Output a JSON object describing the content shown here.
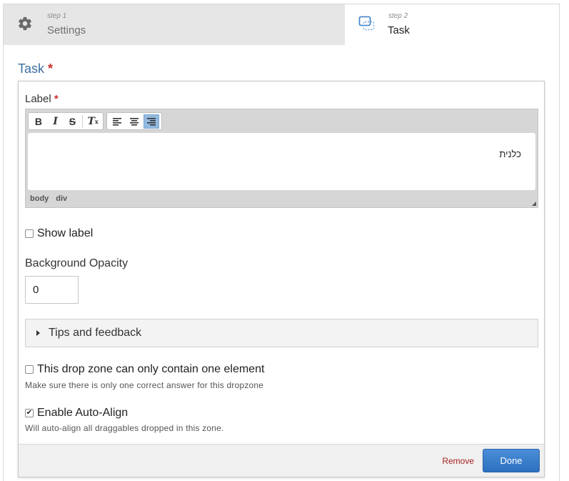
{
  "wizard": {
    "tabs": [
      {
        "step": "step 1",
        "name": "Settings",
        "icon": "gear-icon"
      },
      {
        "step": "step 2",
        "name": "Task",
        "icon": "task-icon"
      }
    ]
  },
  "section": {
    "title": "Task",
    "required_mark": "*"
  },
  "label_field": {
    "title": "Label",
    "required_mark": "*",
    "toolbar": {
      "bold": "B",
      "italic": "I",
      "strike": "S",
      "clear_format": "T",
      "clear_sub": "x"
    },
    "content": "כלנית",
    "path": [
      "body",
      "div"
    ]
  },
  "show_label": {
    "label": "Show label",
    "checked": false
  },
  "background_opacity": {
    "label": "Background Opacity",
    "value": "0"
  },
  "tips": {
    "label": "Tips and feedback"
  },
  "single_element": {
    "label": "This drop zone can only contain one element",
    "description": "Make sure there is only one correct answer for this dropzone",
    "checked": false
  },
  "auto_align": {
    "label": "Enable Auto-Align",
    "description": "Will auto-align all draggables dropped in this zone.",
    "checked": true,
    "check_glyph": "✔"
  },
  "footer": {
    "remove": "Remove",
    "done": "Done"
  },
  "colors": {
    "accent": "#3b6fa0",
    "required": "#c9302c",
    "remove": "#a82222",
    "done": "#2c6fbf"
  }
}
